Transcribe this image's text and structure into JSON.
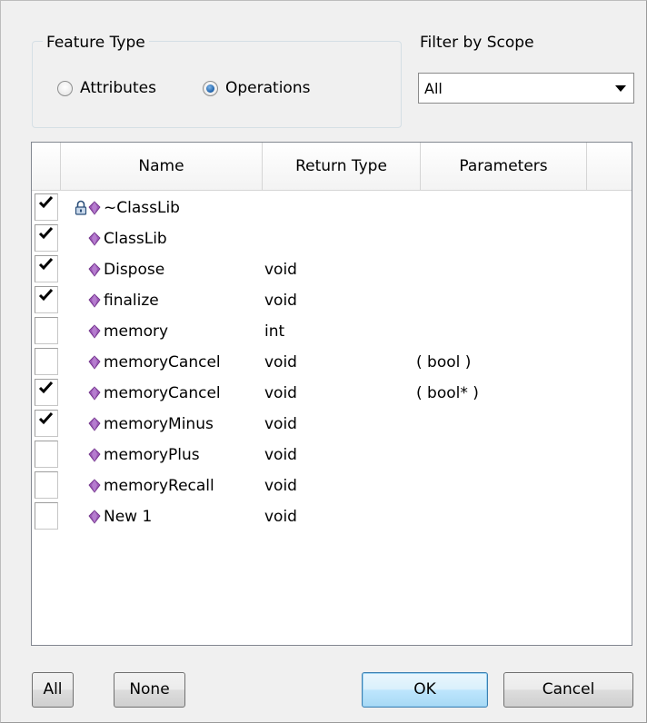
{
  "feature_type": {
    "legend": "Feature Type",
    "options": [
      {
        "label": "Attributes",
        "checked": false
      },
      {
        "label": "Operations",
        "checked": true
      }
    ]
  },
  "filter": {
    "label": "Filter by Scope",
    "selected": "All"
  },
  "table": {
    "columns": [
      "Name",
      "Return Type",
      "Parameters"
    ],
    "rows": [
      {
        "checked": true,
        "locked": true,
        "name": "~ClassLib",
        "return_type": "",
        "parameters": ""
      },
      {
        "checked": true,
        "locked": false,
        "name": "ClassLib",
        "return_type": "",
        "parameters": ""
      },
      {
        "checked": true,
        "locked": false,
        "name": "Dispose",
        "return_type": "void",
        "parameters": ""
      },
      {
        "checked": true,
        "locked": false,
        "name": "finalize",
        "return_type": "void",
        "parameters": ""
      },
      {
        "checked": false,
        "locked": false,
        "name": "memory",
        "return_type": "int",
        "parameters": ""
      },
      {
        "checked": false,
        "locked": false,
        "name": "memoryCancel",
        "return_type": "void",
        "parameters": "( bool )"
      },
      {
        "checked": true,
        "locked": false,
        "name": "memoryCancel",
        "return_type": "void",
        "parameters": "( bool* )"
      },
      {
        "checked": true,
        "locked": false,
        "name": "memoryMinus",
        "return_type": "void",
        "parameters": ""
      },
      {
        "checked": false,
        "locked": false,
        "name": "memoryPlus",
        "return_type": "void",
        "parameters": ""
      },
      {
        "checked": false,
        "locked": false,
        "name": "memoryRecall",
        "return_type": "void",
        "parameters": ""
      },
      {
        "checked": false,
        "locked": false,
        "name": "New 1",
        "return_type": "void",
        "parameters": ""
      }
    ]
  },
  "buttons": {
    "all": "All",
    "none": "None",
    "ok": "OK",
    "cancel": "Cancel"
  },
  "colors": {
    "operation_icon": "#9b59b6",
    "dialog_bg": "#f0f0f0",
    "ok_accent": "#3c7fb1"
  }
}
